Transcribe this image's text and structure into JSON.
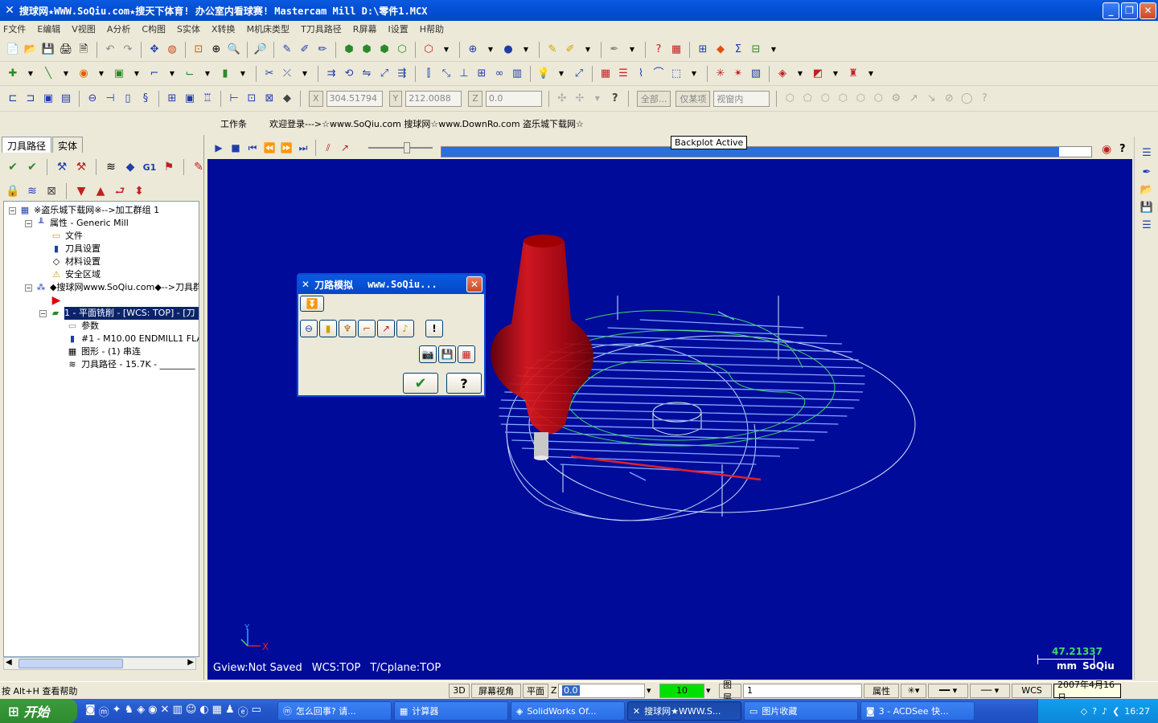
{
  "window": {
    "title": "搜球网★WWW.SoQiu.com★搜天下体育! 办公室内看球赛! Mastercam Mill  D:\\零件1.MCX",
    "minimize": "_",
    "restore": "❐",
    "close": "✕"
  },
  "menu": [
    "F文件",
    "E编辑",
    "V视图",
    "A分析",
    "C构图",
    "S实体",
    "X转换",
    "M机床类型",
    "T刀具路径",
    "R屏幕",
    "I设置",
    "H帮助"
  ],
  "toolbar3": {
    "x_label": "X",
    "x_value": "304.51794",
    "y_label": "Y",
    "y_value": "212.0088",
    "z_label": "Z",
    "z_value": "0.0",
    "all_button": "全部...",
    "only_button": "仅某项",
    "view_select": "视窗内"
  },
  "message_bar": {
    "label": "工作条",
    "text": "欢迎登录--->☆www.SoQiu.com 搜球网☆www.DownRo.com 盗乐城下载网☆"
  },
  "left_panel": {
    "tabs": [
      "刀具路径",
      "实体"
    ],
    "tree": [
      {
        "label": "※盗乐城下载网※-->加工群组 1"
      },
      {
        "label": "属性 - Generic Mill"
      },
      {
        "label": "文件"
      },
      {
        "label": "刀具设置"
      },
      {
        "label": "材料设置"
      },
      {
        "label": "安全区域"
      },
      {
        "label": "◆搜球网www.SoQiu.com◆-->刀具群"
      },
      {
        "label": ""
      },
      {
        "label": "1 - 平面铣削 - [WCS: TOP] - [刀"
      },
      {
        "label": "参数"
      },
      {
        "label": "#1 - M10.00 ENDMILL1 FLAT"
      },
      {
        "label": "图形 - (1) 串连"
      },
      {
        "label": "刀具路径 - 15.7K - ________"
      }
    ]
  },
  "backplot": {
    "tooltip": "Backplot Active",
    "progress": 0.95
  },
  "dialog": {
    "title": "刀路模拟",
    "subtitle": "www.SoQiu...",
    "ok": "✔",
    "help": "?",
    "info": "!"
  },
  "viewport": {
    "bg_color": "#010b9a",
    "gview": "Gview:Not Saved",
    "wcs": "WCS:TOP",
    "tcplane": "T/Cplane:TOP",
    "scale_value": "47.21337",
    "scale_unit": "mm",
    "scale_brand": "SoQiu",
    "axis_y": "Y",
    "axis_x": "X"
  },
  "statusbar": {
    "help": "按 Alt+H 查看帮助",
    "mode3d": "3D",
    "screen_view": "屏幕视角",
    "plane": "平面",
    "z_label": "Z",
    "z_value": "0.0",
    "color_value": "10",
    "layer_label": "图层",
    "layer_value": "1",
    "attr": "属性",
    "wcs": "WCS",
    "date": "2007年4月16日"
  },
  "taskbar": {
    "start": "开始",
    "tasks": [
      "怎么回事? 请...",
      "计算器",
      "SolidWorks Of...",
      "搜球网★WWW.S...",
      "图片收藏",
      "3 - ACDSee 快..."
    ],
    "clock": "16:27"
  }
}
